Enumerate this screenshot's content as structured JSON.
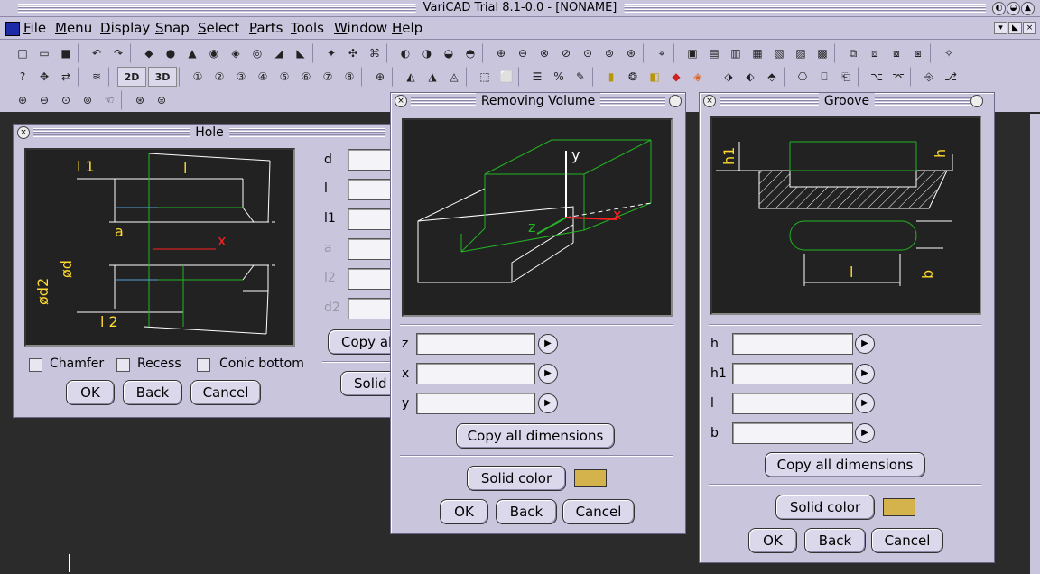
{
  "window": {
    "title": "VariCAD Trial 8.1-0.0 - [NONAME]"
  },
  "menu": [
    "File",
    "Menu",
    "Display",
    "Snap",
    "Select",
    "Parts",
    "Tools",
    "Window",
    "Help"
  ],
  "toolbar": {
    "btn_2d": "2D",
    "btn_3d": "3D"
  },
  "hole": {
    "title": "Hole",
    "labels": {
      "d": "d",
      "l": "l",
      "l1": "l1",
      "a": "a",
      "l2": "l2",
      "d2": "d2"
    },
    "copy_label": "Copy al",
    "solid_label": "Solid",
    "chamfer": "Chamfer",
    "recess": "Recess",
    "conic_bottom": "Conic bottom",
    "ok": "OK",
    "back": "Back",
    "cancel": "Cancel",
    "drawing": {
      "l1": "l 1",
      "l": "l",
      "a": "a",
      "x": "x",
      "d": "ød",
      "d2": "ød2",
      "l2": "l 2"
    }
  },
  "removing": {
    "title": "Removing Volume",
    "labels": {
      "z": "z",
      "x": "x",
      "y": "y"
    },
    "copy_label": "Copy all dimensions",
    "solid_color": "Solid color",
    "ok": "OK",
    "back": "Back",
    "cancel": "Cancel",
    "drawing": {
      "y": "y",
      "z": "z",
      "x": "x"
    }
  },
  "groove": {
    "title": "Groove",
    "labels": {
      "h": "h",
      "h1": "h1",
      "l": "l",
      "b": "b"
    },
    "copy_label": "Copy all dimensions",
    "solid_color": "Solid color",
    "ok": "OK",
    "back": "Back",
    "cancel": "Cancel",
    "drawing": {
      "h1": "h1",
      "h": "h",
      "l": "l",
      "b": "b"
    }
  },
  "colors": {
    "solid_swatch": "#d4b24c",
    "canvas_bg": "#222222",
    "dialog_bg": "#c9c5dd"
  }
}
